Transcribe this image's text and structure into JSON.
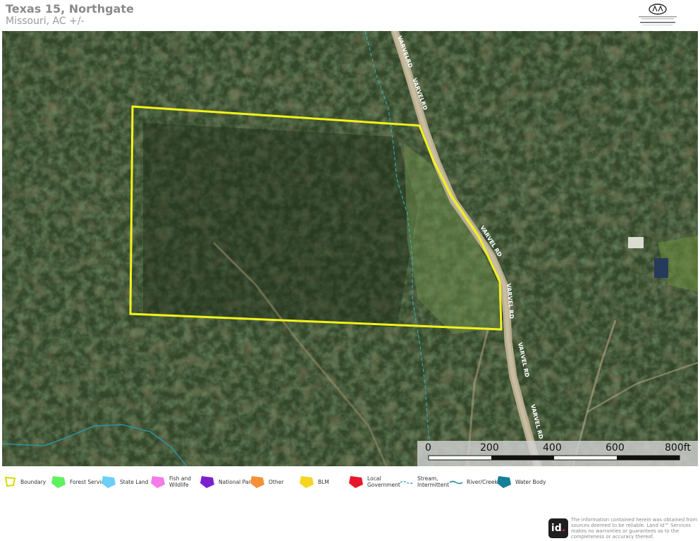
{
  "header": {
    "title": "Texas 15, Northgate",
    "subtitle": "Missouri,  AC +/-"
  },
  "map": {
    "road_labels": [
      "VARVELRD",
      "VARVELRD",
      "VARVEL RD",
      "VARVEL RD",
      "VARVEL RD",
      "VARVEL RD"
    ],
    "boundary_color": "#f2f21a",
    "stream_color": "#33b6c8"
  },
  "scale_bar": {
    "ticks": [
      "0",
      "200",
      "400",
      "600",
      "800ft"
    ]
  },
  "legend": [
    {
      "label": "Boundary",
      "color": "#d9d900",
      "icon": "boundary-outline-icon"
    },
    {
      "label": "Forest Servic",
      "color": "#5ff05f",
      "icon": "forest-service-icon"
    },
    {
      "label": "State Land",
      "color": "#6ccff6",
      "icon": "state-land-icon"
    },
    {
      "label": "Fish and\nWildlife",
      "color": "#f47be8",
      "icon": "fish-wildlife-icon"
    },
    {
      "label": "National Park",
      "color": "#7c1fcf",
      "icon": "national-park-icon"
    },
    {
      "label": "Other",
      "color": "#f59138",
      "icon": "other-icon"
    },
    {
      "label": "BLM",
      "color": "#f5d521",
      "icon": "blm-icon"
    },
    {
      "label": "Local\nGovernment",
      "color": "#e8182a",
      "icon": "local-government-icon"
    },
    {
      "label": "Stream,\nIntermittent",
      "color": "#3aa8c0",
      "icon": "stream-intermittent-icon"
    },
    {
      "label": "River/Creek",
      "color": "#2a8fa6",
      "icon": "river-creek-icon"
    },
    {
      "label": "Water Body",
      "color": "#167f99",
      "icon": "water-body-icon"
    }
  ],
  "footer": {
    "logo_text": "id",
    "disclaimer": "The information contained herein was obtained from sources deemed to be reliable. Land id™ Services makes no warranties or guarantees as to the completeness or accuracy thereof."
  }
}
